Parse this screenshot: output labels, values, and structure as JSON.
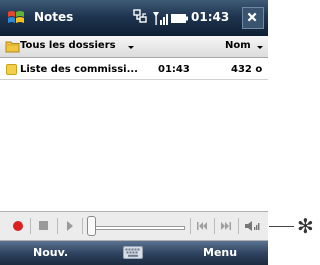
{
  "titlebar": {
    "app_title": "Notes",
    "time": "01:43"
  },
  "header": {
    "folder_label": "Tous les dossiers",
    "sort_label": "Nom"
  },
  "list": {
    "items": [
      {
        "name": "Liste des commissi...",
        "time": "01:43",
        "size": "432 o"
      }
    ]
  },
  "softkeys": {
    "left": "Nouv.",
    "right": "Menu"
  },
  "callout": {
    "mark": "✻"
  }
}
